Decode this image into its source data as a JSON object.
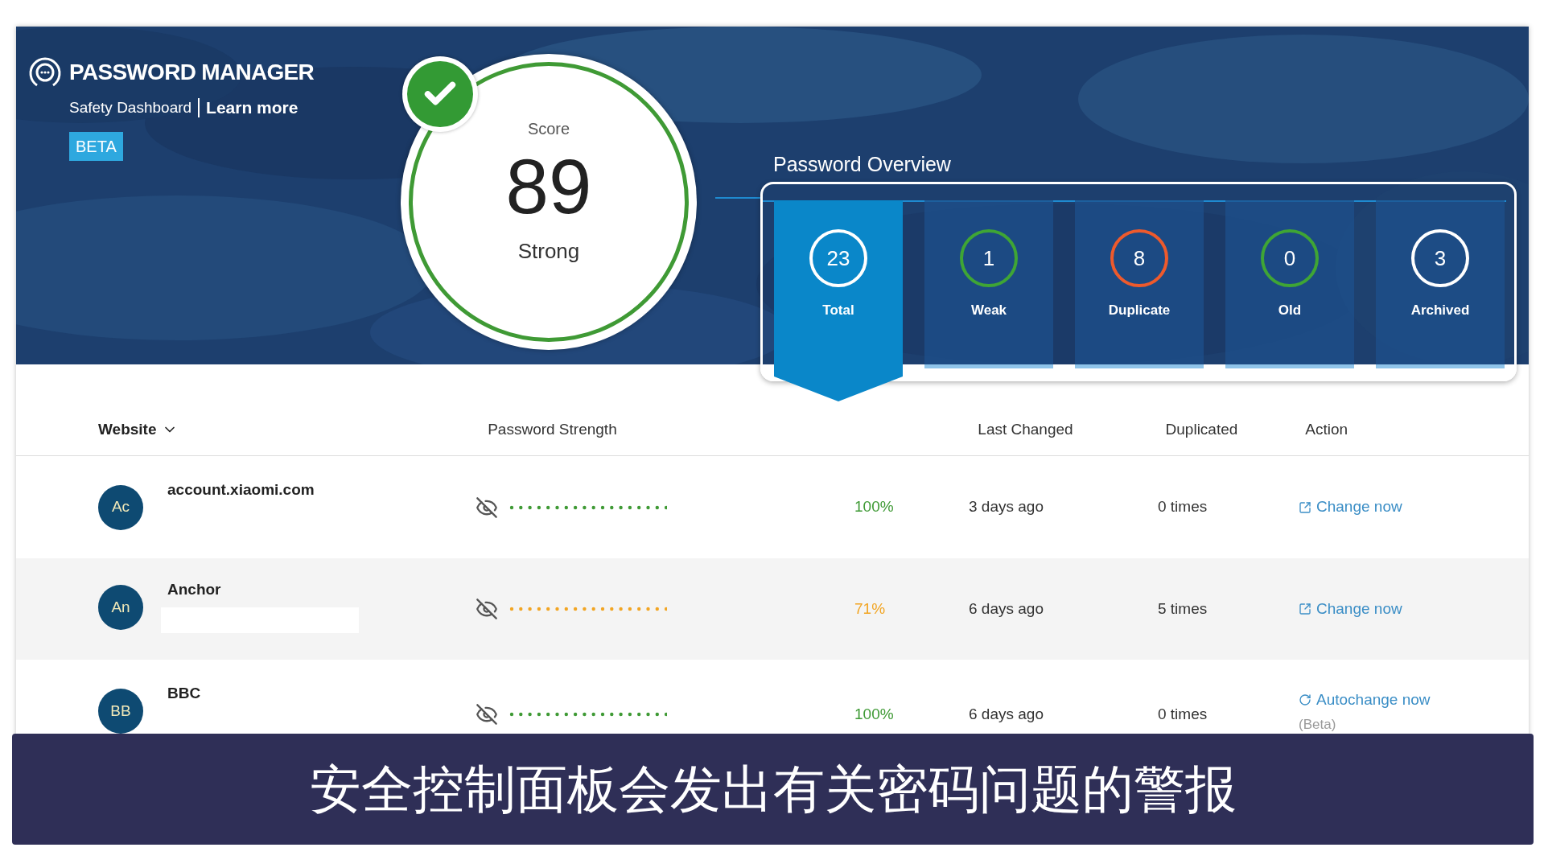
{
  "app": {
    "title": "PASSWORD MANAGER",
    "subtitle": "Safety Dashboard",
    "link": "Learn more",
    "badge": "BETA"
  },
  "score": {
    "label": "Score",
    "value": "89",
    "rating": "Strong",
    "passed": true
  },
  "overview": {
    "title": "Password Overview",
    "tiles": [
      {
        "value": "23",
        "label": "Total",
        "color": "#ffffff",
        "selected": true
      },
      {
        "value": "1",
        "label": "Weak",
        "color": "#3fa535",
        "selected": false
      },
      {
        "value": "8",
        "label": "Duplicate",
        "color": "#ee5a2c",
        "selected": false
      },
      {
        "value": "0",
        "label": "Old",
        "color": "#3fa535",
        "selected": false
      },
      {
        "value": "3",
        "label": "Archived",
        "color": "#ffffff",
        "selected": false
      }
    ]
  },
  "table": {
    "columns": [
      {
        "label": "Website",
        "sorted": true
      },
      {
        "label": "Password Strength",
        "sorted": false
      },
      {
        "label": "Last Changed",
        "sorted": false
      },
      {
        "label": "Duplicated",
        "sorted": false
      },
      {
        "label": "Action",
        "sorted": false
      }
    ],
    "rows": [
      {
        "initials": "Ac",
        "website": "account.xiaomi.com",
        "redacted": false,
        "kind": "strong",
        "percent": "100%",
        "last_changed": "3 days ago",
        "duplicated": "0 times",
        "action": {
          "kind": "change",
          "label": "Change now"
        }
      },
      {
        "initials": "An",
        "website": "Anchor",
        "redacted": true,
        "kind": "fair",
        "percent": "71%",
        "last_changed": "6 days ago",
        "duplicated": "5 times",
        "action": {
          "kind": "change",
          "label": "Change now"
        }
      },
      {
        "initials": "BB",
        "website": "BBC",
        "redacted": false,
        "kind": "strong",
        "percent": "100%",
        "last_changed": "6 days ago",
        "duplicated": "0 times",
        "action": {
          "kind": "autochange",
          "label": "Autochange now",
          "note": "(Beta)"
        }
      }
    ]
  },
  "caption": "安全控制面板会发出有关密码问题的警报"
}
